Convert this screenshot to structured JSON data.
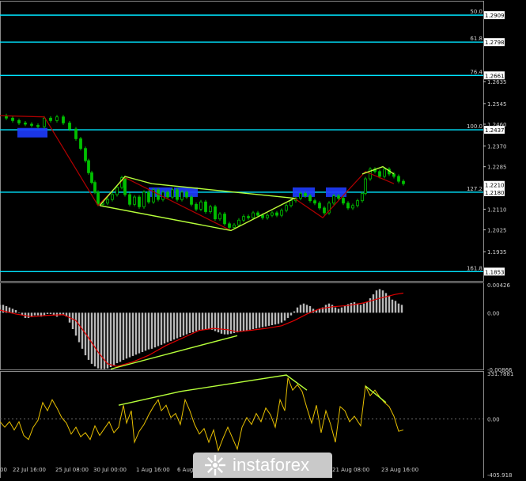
{
  "chart_data": [
    {
      "type": "candlestick",
      "panel": "price",
      "ylim": [
        1.1815,
        1.2955
      ],
      "y_tick_labels": [
        "1.2635",
        "1.2545",
        "1.2460",
        "1.2370",
        "1.2285",
        "1.2110",
        "1.2025",
        "1.1935"
      ],
      "fib_levels": [
        {
          "label": "50.0",
          "price": "1.2909",
          "value": 1.2909
        },
        {
          "label": "61.8",
          "price": "1.2798",
          "value": 1.2798
        },
        {
          "label": "76.4",
          "price": "1.2661",
          "value": 1.2661
        },
        {
          "label": "100.0",
          "price": "1.2437",
          "value": 1.2437
        },
        {
          "label": "127.2",
          "price": "1.2180",
          "value": 1.218
        },
        {
          "label": "161.8",
          "price": "1.1853",
          "value": 1.1853
        }
      ],
      "current_price": "1.2210",
      "current_value": 1.221,
      "x_labels": [
        "00",
        "22 Jul 16:00",
        "25 Jul 08:00",
        "30 Jul 00:00",
        "1 Aug 16:00",
        "6 Aug",
        "21 Aug 08:00",
        "23 Aug 16:00"
      ],
      "close_path": [
        [
          0,
          1.2495
        ],
        [
          8,
          1.2485
        ],
        [
          16,
          1.2475
        ],
        [
          24,
          1.2465
        ],
        [
          32,
          1.246
        ],
        [
          40,
          1.2455
        ],
        [
          48,
          1.245
        ],
        [
          56,
          1.2485
        ],
        [
          64,
          1.2475
        ],
        [
          72,
          1.249
        ],
        [
          80,
          1.2465
        ],
        [
          88,
          1.244
        ],
        [
          96,
          1.24
        ],
        [
          102,
          1.236
        ],
        [
          108,
          1.231
        ],
        [
          112,
          1.226
        ],
        [
          116,
          1.222
        ],
        [
          120,
          1.218
        ],
        [
          124,
          1.213
        ],
        [
          130,
          1.2135
        ],
        [
          136,
          1.215
        ],
        [
          142,
          1.217
        ],
        [
          148,
          1.22
        ],
        [
          154,
          1.224
        ],
        [
          158,
          1.217
        ],
        [
          164,
          1.213
        ],
        [
          170,
          1.216
        ],
        [
          176,
          1.212
        ],
        [
          182,
          1.218
        ],
        [
          188,
          1.214
        ],
        [
          194,
          1.219
        ],
        [
          200,
          1.215
        ],
        [
          206,
          1.218
        ],
        [
          212,
          1.216
        ],
        [
          218,
          1.219
        ],
        [
          224,
          1.215
        ],
        [
          230,
          1.218
        ],
        [
          236,
          1.216
        ],
        [
          242,
          1.213
        ],
        [
          248,
          1.211
        ],
        [
          254,
          1.214
        ],
        [
          260,
          1.21
        ],
        [
          266,
          1.212
        ],
        [
          272,
          1.207
        ],
        [
          278,
          1.209
        ],
        [
          284,
          1.205
        ],
        [
          290,
          1.2035
        ],
        [
          296,
          1.2045
        ],
        [
          302,
          1.2065
        ],
        [
          308,
          1.208
        ],
        [
          314,
          1.2075
        ],
        [
          320,
          1.2095
        ],
        [
          326,
          1.2085
        ],
        [
          332,
          1.2075
        ],
        [
          338,
          1.2085
        ],
        [
          344,
          1.2095
        ],
        [
          350,
          1.2085
        ],
        [
          356,
          1.2105
        ],
        [
          362,
          1.2125
        ],
        [
          368,
          1.2145
        ],
        [
          374,
          1.2155
        ],
        [
          380,
          1.2175
        ],
        [
          386,
          1.2165
        ],
        [
          392,
          1.2145
        ],
        [
          398,
          1.2135
        ],
        [
          404,
          1.2115
        ],
        [
          410,
          1.2095
        ],
        [
          416,
          1.2135
        ],
        [
          422,
          1.2165
        ],
        [
          428,
          1.2155
        ],
        [
          434,
          1.2135
        ],
        [
          440,
          1.2115
        ],
        [
          446,
          1.2125
        ],
        [
          452,
          1.2145
        ],
        [
          458,
          1.2175
        ],
        [
          462,
          1.2235
        ],
        [
          468,
          1.2275
        ],
        [
          474,
          1.2265
        ],
        [
          480,
          1.2245
        ],
        [
          486,
          1.2275
        ],
        [
          492,
          1.2255
        ],
        [
          498,
          1.2245
        ],
        [
          504,
          1.2225
        ],
        [
          510,
          1.2215
        ]
      ]
    },
    {
      "type": "bar",
      "panel": "macd",
      "ylim": [
        -0.00866,
        0.00426
      ],
      "y_tick_labels": [
        "0.00426",
        "0.00",
        "-0.00866"
      ],
      "x": [
        0,
        4,
        8,
        12,
        16,
        20,
        24,
        28,
        32,
        36,
        40,
        44,
        48,
        52,
        56,
        60,
        64,
        68,
        72,
        76,
        80,
        84,
        88,
        92,
        96,
        100,
        104,
        108,
        112,
        116,
        120,
        124,
        128,
        132,
        136,
        140,
        144,
        148,
        152,
        156,
        160,
        164,
        168,
        172,
        176,
        180,
        184,
        188,
        192,
        196,
        200,
        204,
        208,
        212,
        216,
        220,
        224,
        228,
        232,
        236,
        240,
        244,
        248,
        252,
        256,
        260,
        264,
        268,
        272,
        276,
        280,
        284,
        288,
        292,
        296,
        300,
        304,
        308,
        312,
        316,
        320,
        324,
        328,
        332,
        336,
        340,
        344,
        348,
        352,
        356,
        360,
        364,
        368,
        372,
        376,
        380,
        384,
        388,
        392,
        396,
        400,
        404,
        408,
        412,
        416,
        420,
        424,
        428,
        432,
        436,
        440,
        444,
        448,
        452,
        456,
        460,
        464,
        468,
        472,
        476,
        480,
        484,
        488,
        492,
        496,
        500,
        504,
        508
      ],
      "values": [
        0.0012,
        0.0012,
        0.001,
        0.0008,
        0.0006,
        0.0004,
        0,
        -0.0004,
        -0.0008,
        -0.0008,
        -0.0006,
        -0.0004,
        -0.0004,
        -0.0006,
        -0.0004,
        -0.0002,
        -0.0002,
        -0.0004,
        -0.0006,
        -0.0004,
        -0.0004,
        -0.0006,
        -0.0015,
        -0.0025,
        -0.0035,
        -0.0045,
        -0.0055,
        -0.0065,
        -0.0072,
        -0.0078,
        -0.0082,
        -0.0085,
        -0.0086,
        -0.0086,
        -0.0085,
        -0.0083,
        -0.008,
        -0.0077,
        -0.0075,
        -0.0072,
        -0.007,
        -0.0068,
        -0.0066,
        -0.0064,
        -0.0062,
        -0.006,
        -0.0058,
        -0.0056,
        -0.0055,
        -0.0053,
        -0.0051,
        -0.0049,
        -0.0047,
        -0.0045,
        -0.0043,
        -0.0041,
        -0.0039,
        -0.0037,
        -0.0035,
        -0.0033,
        -0.0031,
        -0.003,
        -0.0028,
        -0.0027,
        -0.0026,
        -0.0025,
        -0.0025,
        -0.0026,
        -0.0028,
        -0.003,
        -0.0032,
        -0.0033,
        -0.0033,
        -0.0032,
        -0.0031,
        -0.003,
        -0.0029,
        -0.0028,
        -0.0027,
        -0.0026,
        -0.0025,
        -0.0024,
        -0.0023,
        -0.0022,
        -0.0021,
        -0.002,
        -0.0019,
        -0.0018,
        -0.0017,
        -0.0015,
        -0.0012,
        -0.0008,
        -0.0004,
        0.0002,
        0.0008,
        0.0012,
        0.0014,
        0.0012,
        0.001,
        0.0006,
        0.0004,
        0.0006,
        0.0008,
        0.0012,
        0.0014,
        0.0012,
        0.0008,
        0.0006,
        0.0008,
        0.0011,
        0.0013,
        0.0015,
        0.0016,
        0.0014,
        0.0012,
        0.0014,
        0.0016,
        0.0022,
        0.0028,
        0.0034,
        0.0036,
        0.0034,
        0.003,
        0.0026,
        0.002,
        0.0018,
        0.0014,
        0.0012
      ],
      "signal_path": [
        [
          0,
          0.0004
        ],
        [
          20,
          -0.0002
        ],
        [
          40,
          -0.0006
        ],
        [
          60,
          -0.0004
        ],
        [
          80,
          -0.0003
        ],
        [
          96,
          -0.0012
        ],
        [
          110,
          -0.0035
        ],
        [
          124,
          -0.006
        ],
        [
          136,
          -0.0078
        ],
        [
          148,
          -0.0082
        ],
        [
          168,
          -0.0075
        ],
        [
          188,
          -0.0065
        ],
        [
          210,
          -0.005
        ],
        [
          232,
          -0.0038
        ],
        [
          252,
          -0.0027
        ],
        [
          270,
          -0.0024
        ],
        [
          288,
          -0.0026
        ],
        [
          300,
          -0.0029
        ],
        [
          316,
          -0.0027
        ],
        [
          336,
          -0.0024
        ],
        [
          356,
          -0.002
        ],
        [
          372,
          -0.0012
        ],
        [
          388,
          -0.0002
        ],
        [
          404,
          0.0006
        ],
        [
          420,
          0.0009
        ],
        [
          440,
          0.0011
        ],
        [
          460,
          0.0015
        ],
        [
          480,
          0.0022
        ],
        [
          500,
          0.0028
        ],
        [
          510,
          0.003
        ]
      ]
    },
    {
      "type": "line",
      "panel": "cci",
      "ylim": [
        -405.918,
        331.7881
      ],
      "y_tick_labels": [
        "331.7881",
        "0.00",
        "-405.918"
      ],
      "values_path": [
        [
          0,
          -20
        ],
        [
          6,
          -60
        ],
        [
          12,
          -20
        ],
        [
          18,
          -80
        ],
        [
          24,
          -20
        ],
        [
          30,
          -120
        ],
        [
          36,
          -150
        ],
        [
          42,
          -60
        ],
        [
          48,
          -10
        ],
        [
          54,
          120
        ],
        [
          60,
          60
        ],
        [
          66,
          140
        ],
        [
          72,
          80
        ],
        [
          78,
          10
        ],
        [
          84,
          -30
        ],
        [
          90,
          -110
        ],
        [
          96,
          -60
        ],
        [
          102,
          -130
        ],
        [
          108,
          -100
        ],
        [
          114,
          -150
        ],
        [
          120,
          -50
        ],
        [
          126,
          -120
        ],
        [
          132,
          -70
        ],
        [
          138,
          -20
        ],
        [
          144,
          -100
        ],
        [
          150,
          -60
        ],
        [
          156,
          100
        ],
        [
          160,
          -30
        ],
        [
          166,
          60
        ],
        [
          170,
          -170
        ],
        [
          176,
          -90
        ],
        [
          182,
          -40
        ],
        [
          188,
          30
        ],
        [
          194,
          90
        ],
        [
          200,
          140
        ],
        [
          204,
          60
        ],
        [
          210,
          100
        ],
        [
          216,
          10
        ],
        [
          222,
          40
        ],
        [
          228,
          -40
        ],
        [
          234,
          140
        ],
        [
          240,
          60
        ],
        [
          246,
          -40
        ],
        [
          252,
          -110
        ],
        [
          258,
          -70
        ],
        [
          264,
          -170
        ],
        [
          270,
          -80
        ],
        [
          276,
          -230
        ],
        [
          282,
          -140
        ],
        [
          288,
          -60
        ],
        [
          294,
          -140
        ],
        [
          300,
          -220
        ],
        [
          306,
          -60
        ],
        [
          312,
          10
        ],
        [
          318,
          -40
        ],
        [
          324,
          40
        ],
        [
          330,
          -20
        ],
        [
          336,
          80
        ],
        [
          342,
          30
        ],
        [
          348,
          -60
        ],
        [
          354,
          140
        ],
        [
          360,
          60
        ],
        [
          364,
          300
        ],
        [
          370,
          210
        ],
        [
          376,
          250
        ],
        [
          382,
          200
        ],
        [
          388,
          80
        ],
        [
          394,
          -30
        ],
        [
          400,
          100
        ],
        [
          406,
          -100
        ],
        [
          412,
          60
        ],
        [
          418,
          -40
        ],
        [
          424,
          -170
        ],
        [
          430,
          90
        ],
        [
          436,
          60
        ],
        [
          442,
          -20
        ],
        [
          448,
          20
        ],
        [
          456,
          -50
        ],
        [
          462,
          240
        ],
        [
          468,
          170
        ],
        [
          474,
          210
        ],
        [
          480,
          160
        ],
        [
          486,
          120
        ],
        [
          492,
          90
        ],
        [
          498,
          20
        ],
        [
          504,
          -90
        ],
        [
          510,
          -80
        ]
      ]
    }
  ],
  "divergence_lines": [
    {
      "panel": "price",
      "points": [
        [
          126,
          1.2125
        ],
        [
          158,
          1.2245
        ],
        [
          192,
          1.2215
        ],
        [
          372,
          1.2155
        ],
        [
          292,
          1.2022
        ],
        [
          126,
          1.2125
        ]
      ]
    },
    {
      "panel": "price",
      "points": [
        [
          458,
          1.2255
        ],
        [
          484,
          1.2285
        ],
        [
          498,
          1.2255
        ]
      ]
    },
    {
      "panel": "macd",
      "points": [
        [
          140,
          -0.0086
        ],
        [
          300,
          -0.0035
        ]
      ]
    },
    {
      "panel": "cci",
      "points": [
        [
          150,
          100
        ],
        [
          228,
          200
        ],
        [
          362,
          320
        ],
        [
          388,
          210
        ]
      ]
    },
    {
      "panel": "cci",
      "points": [
        [
          462,
          240
        ],
        [
          488,
          120
        ]
      ]
    }
  ],
  "zigzag": [
    [
      0,
      1.2495
    ],
    [
      56,
      1.249
    ],
    [
      124,
      1.2125
    ],
    [
      158,
      1.224
    ],
    [
      292,
      1.2022
    ],
    [
      372,
      1.2155
    ],
    [
      408,
      1.2075
    ],
    [
      462,
      1.2265
    ],
    [
      498,
      1.2215
    ]
  ],
  "blue_boxes": [
    [
      22,
      1.2425,
      38,
      12
    ],
    [
      188,
      1.218,
      30,
      12
    ],
    [
      220,
      1.218,
      30,
      12
    ],
    [
      370,
      1.218,
      28,
      12
    ],
    [
      412,
      1.218,
      26,
      12
    ]
  ],
  "colors": {
    "background": "#000000",
    "candle": "#00c000",
    "fib_line": "#00e5ff",
    "histogram": "#b8b8b8",
    "signal": "#e00000",
    "cci": "#e8c000",
    "divergence": "#b6ff3a",
    "box": "#1e3cff",
    "zigzag": "#b00000",
    "axis": "#cfcfcf"
  },
  "watermark": {
    "brand": "instaforex",
    "logo_icon": "instaforex-logo-icon"
  }
}
